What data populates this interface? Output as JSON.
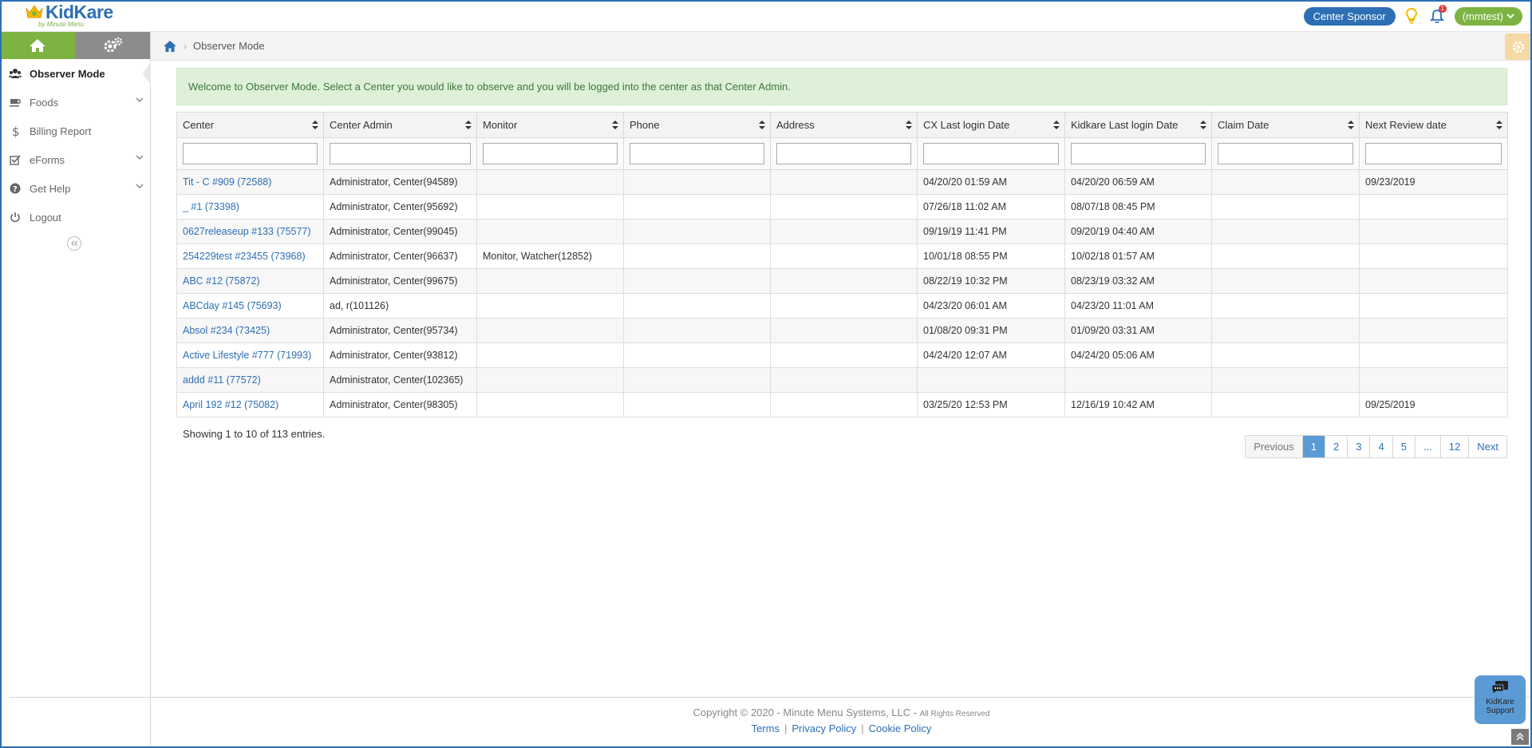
{
  "app": {
    "logo_text": "KidKare",
    "logo_sub": "by Minute Menu"
  },
  "header": {
    "sponsor_label": "Center Sponsor",
    "notification_count": "1",
    "user_label": "(mmtest)"
  },
  "sidebar": {
    "items": [
      {
        "label": "Observer Mode",
        "icon": "users-icon"
      },
      {
        "label": "Foods",
        "icon": "coffee-cup-icon"
      },
      {
        "label": "Billing Report",
        "icon": "dollar-icon"
      },
      {
        "label": "eForms",
        "icon": "checkbox-icon"
      },
      {
        "label": "Get Help",
        "icon": "question-icon"
      },
      {
        "label": "Logout",
        "icon": "power-icon"
      }
    ]
  },
  "breadcrumb": {
    "current": "Observer Mode"
  },
  "alert": {
    "message": "Welcome to Observer Mode. Select a Center you would like to observe and you will be logged into the center as that Center Admin."
  },
  "table": {
    "columns": [
      "Center",
      "Center Admin",
      "Monitor",
      "Phone",
      "Address",
      "CX Last login Date",
      "Kidkare Last login Date",
      "Claim Date",
      "Next Review date"
    ],
    "rows": [
      {
        "center": "Tit - C #909 (72588)",
        "admin": "Administrator, Center(94589)",
        "monitor": "",
        "phone": "",
        "address": "",
        "cx_login": "04/20/20 01:59 AM",
        "kk_login": "04/20/20 06:59 AM",
        "claim": "",
        "review": "09/23/2019"
      },
      {
        "center": "_ #1 (73398)",
        "admin": "Administrator, Center(95692)",
        "monitor": "",
        "phone": "",
        "address": "",
        "cx_login": "07/26/18 11:02 AM",
        "kk_login": "08/07/18 08:45 PM",
        "claim": "",
        "review": ""
      },
      {
        "center": "0627releaseup #133 (75577)",
        "admin": "Administrator, Center(99045)",
        "monitor": "",
        "phone": "",
        "address": "",
        "cx_login": "09/19/19 11:41 PM",
        "kk_login": "09/20/19 04:40 AM",
        "claim": "",
        "review": ""
      },
      {
        "center": "254229test #23455 (73968)",
        "admin": "Administrator, Center(96637)",
        "monitor": "Monitor, Watcher(12852)",
        "phone": "",
        "address": "",
        "cx_login": "10/01/18 08:55 PM",
        "kk_login": "10/02/18 01:57 AM",
        "claim": "",
        "review": ""
      },
      {
        "center": "ABC #12 (75872)",
        "admin": "Administrator, Center(99675)",
        "monitor": "",
        "phone": "",
        "address": "",
        "cx_login": "08/22/19 10:32 PM",
        "kk_login": "08/23/19 03:32 AM",
        "claim": "",
        "review": ""
      },
      {
        "center": "ABCday #145 (75693)",
        "admin": "ad, r(101126)",
        "monitor": "",
        "phone": "",
        "address": "",
        "cx_login": "04/23/20 06:01 AM",
        "kk_login": "04/23/20 11:01 AM",
        "claim": "",
        "review": ""
      },
      {
        "center": "Absol #234 (73425)",
        "admin": "Administrator, Center(95734)",
        "monitor": "",
        "phone": "",
        "address": "",
        "cx_login": "01/08/20 09:31 PM",
        "kk_login": "01/09/20 03:31 AM",
        "claim": "",
        "review": ""
      },
      {
        "center": "Active Lifestyle #777 (71993)",
        "admin": "Administrator, Center(93812)",
        "monitor": "",
        "phone": "",
        "address": "",
        "cx_login": "04/24/20 12:07 AM",
        "kk_login": "04/24/20 05:06 AM",
        "claim": "",
        "review": ""
      },
      {
        "center": "addd #11 (77572)",
        "admin": "Administrator, Center(102365)",
        "monitor": "",
        "phone": "",
        "address": "",
        "cx_login": "",
        "kk_login": "",
        "claim": "",
        "review": ""
      },
      {
        "center": "April 192 #12 (75082)",
        "admin": "Administrator, Center(98305)",
        "monitor": "",
        "phone": "",
        "address": "",
        "cx_login": "03/25/20 12:53 PM",
        "kk_login": "12/16/19 10:42 AM",
        "claim": "",
        "review": "09/25/2019"
      }
    ]
  },
  "showing_text": "Showing 1 to 10 of 113 entries.",
  "pagination": [
    "Previous",
    "1",
    "2",
    "3",
    "4",
    "5",
    "...",
    "12",
    "Next"
  ],
  "footer": {
    "copyright": "Copyright © 2020 - Minute Menu Systems, LLC - ",
    "rights": "All Rights Reserved",
    "links": [
      "Terms",
      "Privacy Policy",
      "Cookie Policy"
    ]
  },
  "support": {
    "line1": "KidKare",
    "line2": "Support"
  },
  "colors": {
    "brand_blue": "#2d6fb4",
    "brand_green": "#7cb342",
    "alert_bg": "#dff0d8",
    "alert_text": "#3c763d"
  }
}
